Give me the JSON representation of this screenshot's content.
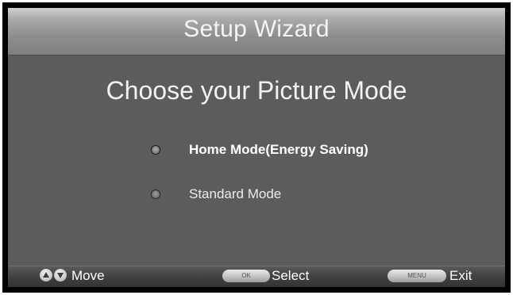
{
  "header": {
    "title": "Setup Wizard"
  },
  "main": {
    "heading": "Choose your Picture Mode",
    "options": [
      {
        "label": "Home Mode(Energy Saving)",
        "selected": true
      },
      {
        "label": "Standard Mode",
        "selected": false
      }
    ]
  },
  "footer": {
    "move": {
      "icons": [
        "arrow-up-icon",
        "arrow-down-icon"
      ],
      "label": "Move"
    },
    "select": {
      "key": "OK",
      "label": "Select"
    },
    "exit": {
      "key": "MENU",
      "label": "Exit"
    }
  },
  "colors": {
    "background": "#5c5c5c",
    "header": "#9a9a9a",
    "footer": "#3c3c3c",
    "text": "#ffffff"
  }
}
